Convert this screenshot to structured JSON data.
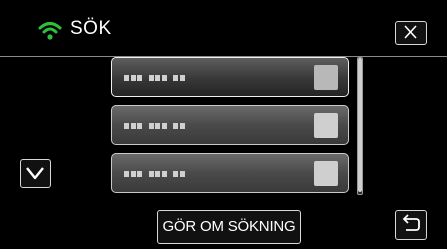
{
  "header": {
    "title": "SÖK",
    "status_icon": "wifi-icon",
    "accent_color": "#2fbf3a"
  },
  "close_button": {
    "icon": "close-icon"
  },
  "list": {
    "items": [
      {
        "obscured_label": "▪▪▪ ▪▪▪ ▪▪",
        "selected": true
      },
      {
        "obscured_label": "▪▪▪ ▪▪▪ ▪▪",
        "selected": false
      },
      {
        "obscured_label": "▪▪▪ ▪▪▪ ▪▪",
        "selected": false
      }
    ]
  },
  "scroll_down_button": {
    "icon": "chevron-down-icon"
  },
  "redo_search_button": {
    "label": "GÖR OM SÖKNING"
  },
  "back_button": {
    "icon": "return-arrow-icon"
  }
}
